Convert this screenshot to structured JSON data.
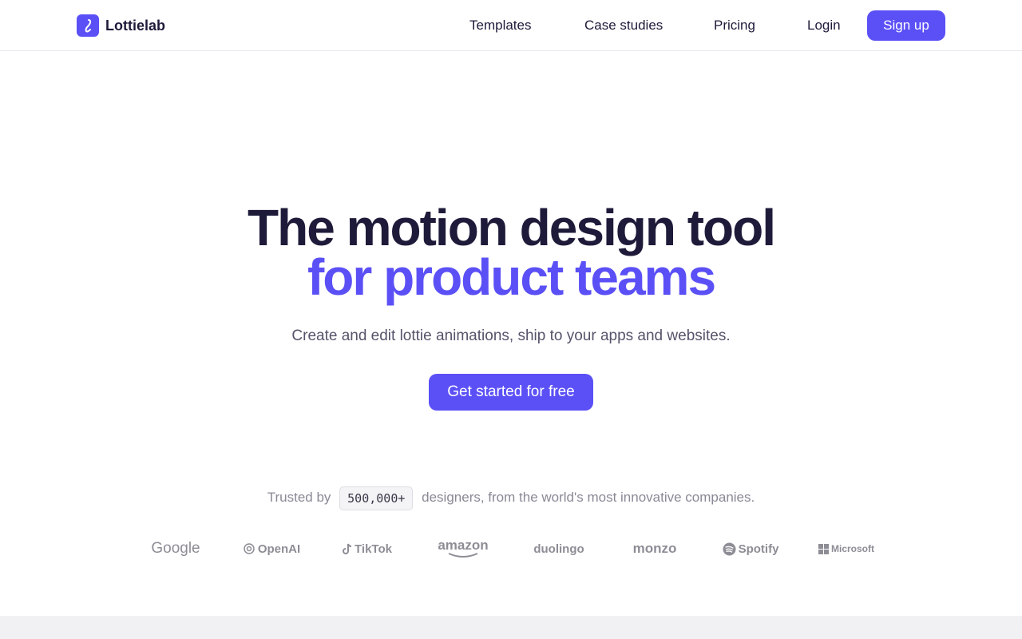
{
  "header": {
    "logo_text": "Lottielab",
    "nav": [
      "Templates",
      "Case studies",
      "Pricing",
      "Login"
    ],
    "signup_label": "Sign up"
  },
  "hero": {
    "title_line1": "The motion design tool",
    "title_line2": "for product teams",
    "subtitle": "Create and edit lottie animations, ship to your apps and websites.",
    "cta_label": "Get started for free"
  },
  "trust": {
    "prefix": "Trusted by",
    "count": "500,000+",
    "suffix": "designers, from the world's most innovative companies."
  },
  "companies": [
    "Google",
    "OpenAI",
    "TikTok",
    "amazon",
    "duolingo",
    "monzo",
    "Spotify",
    "Microsoft"
  ],
  "colors": {
    "accent": "#5b50f6",
    "text": "#1e1b3a",
    "muted": "#8a8996"
  }
}
